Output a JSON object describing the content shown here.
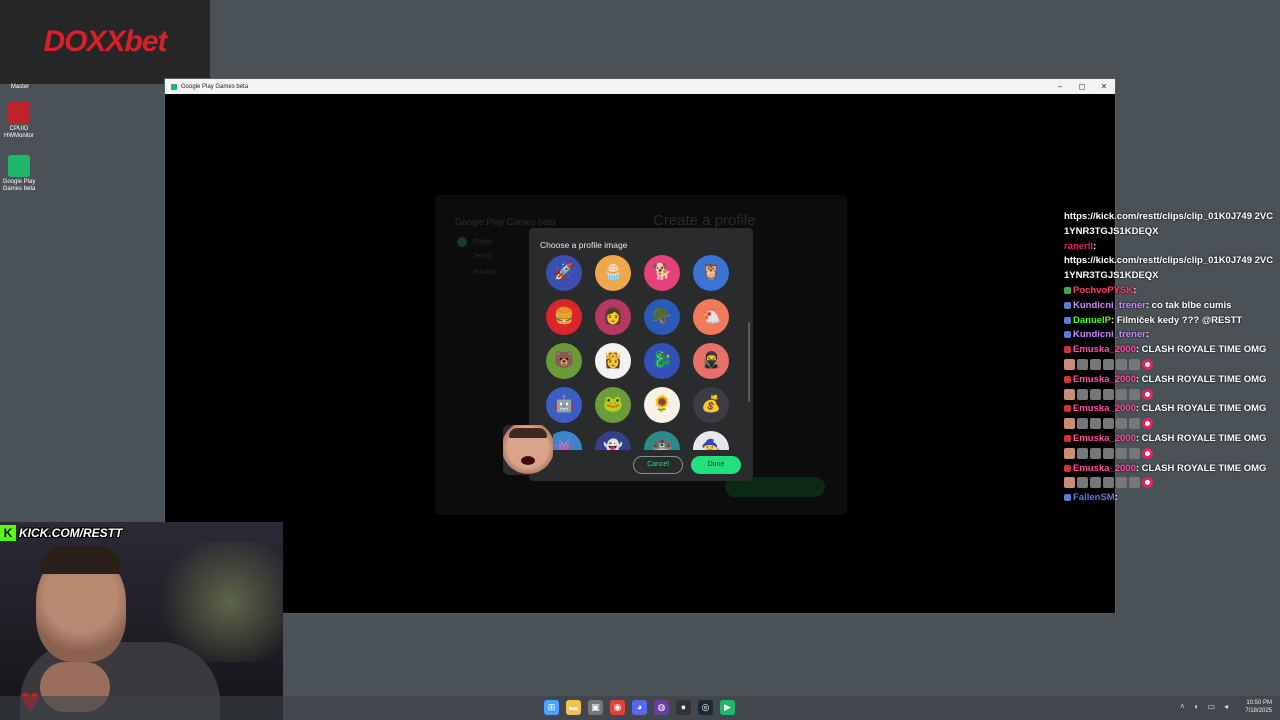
{
  "brand": {
    "name": "DOXXbet"
  },
  "desktop": {
    "icons": [
      {
        "label": "Master"
      },
      {
        "label": "CPUID HWMonitor"
      },
      {
        "label": "Google Play Games beta"
      }
    ]
  },
  "window": {
    "title": "Google Play Games beta",
    "minimize": "–",
    "maximize": "◻",
    "close": "✕"
  },
  "background_screen": {
    "app_name": "Google Play Games beta",
    "heading": "Create a profile",
    "nav": [
      "Profile",
      "Terms",
      "Privacy"
    ]
  },
  "dialog": {
    "title": "Choose a profile image",
    "cancel_label": "Cancel",
    "done_label": "Done",
    "avatars": [
      {
        "icon": "spaceship-icon",
        "glyph": "🚀",
        "bg": "#3b4fb0"
      },
      {
        "icon": "treasure-chest-icon",
        "glyph": "🧁",
        "bg": "#f0a64a"
      },
      {
        "icon": "shiba-dog-icon",
        "glyph": "🐕",
        "bg": "#e5427c"
      },
      {
        "icon": "astronaut-owl-icon",
        "glyph": "🦉",
        "bg": "#3a74d6"
      },
      {
        "icon": "burger-icon",
        "glyph": "🍔",
        "bg": "#d8262c"
      },
      {
        "icon": "warrior-woman-icon",
        "glyph": "👩",
        "bg": "#b73663"
      },
      {
        "icon": "knight-helmet-icon",
        "glyph": "🪖",
        "bg": "#2b5ab6"
      },
      {
        "icon": "chicken-icon",
        "glyph": "🐔",
        "bg": "#ef7b5a"
      },
      {
        "icon": "bear-icon",
        "glyph": "🐻",
        "bg": "#6a9a3a"
      },
      {
        "icon": "princess-icon",
        "glyph": "👸",
        "bg": "#f2f2f2"
      },
      {
        "icon": "dragon-icon",
        "glyph": "🐉",
        "bg": "#3350b8"
      },
      {
        "icon": "ninja-icon",
        "glyph": "🥷",
        "bg": "#e9706a"
      },
      {
        "icon": "robot-icon",
        "glyph": "🤖",
        "bg": "#3c5cc6"
      },
      {
        "icon": "frog-icon",
        "glyph": "🐸",
        "bg": "#6a9c3c"
      },
      {
        "icon": "sunflower-icon",
        "glyph": "🌻",
        "bg": "#f7f2e6"
      },
      {
        "icon": "treasure-icon",
        "glyph": "💰",
        "bg": "#3b3d42"
      },
      {
        "icon": "pink-monster-icon",
        "glyph": "👾",
        "bg": "#3a86c8"
      },
      {
        "icon": "ghost-icon",
        "glyph": "👻",
        "bg": "#36408a"
      },
      {
        "icon": "tower-icon",
        "glyph": "🏰",
        "bg": "#2d8a86"
      },
      {
        "icon": "wizard-icon",
        "glyph": "🧙",
        "bg": "#e8e8ec"
      }
    ]
  },
  "chat": {
    "lines": [
      {
        "user": "",
        "text": "https://kick.com/restt/clips/clip_01K0J749 2VC1YNR3TGJS1KDEQX",
        "user_color": "#ffffff",
        "badge": ""
      },
      {
        "user": "ranerll",
        "text": ":",
        "user_color": "#e0245e",
        "badge": ""
      },
      {
        "user": "",
        "text": "https://kick.com/restt/clips/clip_01K0J749 2VC1YNR3TGJS1KDEQX",
        "user_color": "#ffffff",
        "badge": ""
      },
      {
        "user": "PochvoPYSK",
        "text": ":",
        "user_color": "#ff3b6b",
        "badge": "green"
      },
      {
        "user": "Kundicni_trener",
        "text": ": co tak blbe cumis",
        "user_color": "#c889ff",
        "badge": "blue"
      },
      {
        "user": "DanuelP",
        "text": ": Filmíček kedy ??? @RESTT",
        "user_color": "#53fc18",
        "badge": "blue"
      },
      {
        "user": "Kundicni_trener",
        "text": ":",
        "user_color": "#c889ff",
        "badge": "blue"
      },
      {
        "user": "Emuska_2000",
        "text": ": CLASH ROYALE TIME OMG",
        "user_color": "#ff4fa0",
        "badge": "red"
      },
      {
        "user": "Emuska_2000",
        "text": ": CLASH ROYALE TIME OMG",
        "user_color": "#ff4fa0",
        "badge": "red"
      },
      {
        "user": "Emuska_2000",
        "text": ": CLASH ROYALE TIME OMG",
        "user_color": "#ff4fa0",
        "badge": "red"
      },
      {
        "user": "Emuska_2000",
        "text": ": CLASH ROYALE TIME OMG",
        "user_color": "#ff4fa0",
        "badge": "red"
      },
      {
        "user": "Emuska_2000",
        "text": ": CLASH ROYALE TIME OMG",
        "user_color": "#ff4fa0",
        "badge": "red"
      },
      {
        "user": "FallenSM",
        "text": ":",
        "user_color": "#5b7bd5",
        "badge": "blue"
      }
    ]
  },
  "webcam": {
    "kick_handle": "KICK.COM/RESTT",
    "kick_k": "K"
  },
  "taskbar": {
    "apps": [
      {
        "icon": "windows-start-icon",
        "glyph": "⊞",
        "color": "#4aa3ff"
      },
      {
        "icon": "file-explorer-icon",
        "glyph": "▬",
        "color": "#f2c14e"
      },
      {
        "icon": "terminal-icon",
        "glyph": "▣",
        "color": "#777777"
      },
      {
        "icon": "chrome-icon",
        "glyph": "◉",
        "color": "#e34133"
      },
      {
        "icon": "discord-icon",
        "glyph": "◕",
        "color": "#5865f2"
      },
      {
        "icon": "obs-icon",
        "glyph": "◍",
        "color": "#6a3ea1"
      },
      {
        "icon": "app-icon",
        "glyph": "●",
        "color": "#333333"
      },
      {
        "icon": "steam-icon",
        "glyph": "◎",
        "color": "#1b2838"
      },
      {
        "icon": "google-play-games-icon",
        "glyph": "▶",
        "color": "#1fb86b"
      }
    ],
    "time": "10:50 PM",
    "date": "7/18/2025"
  }
}
